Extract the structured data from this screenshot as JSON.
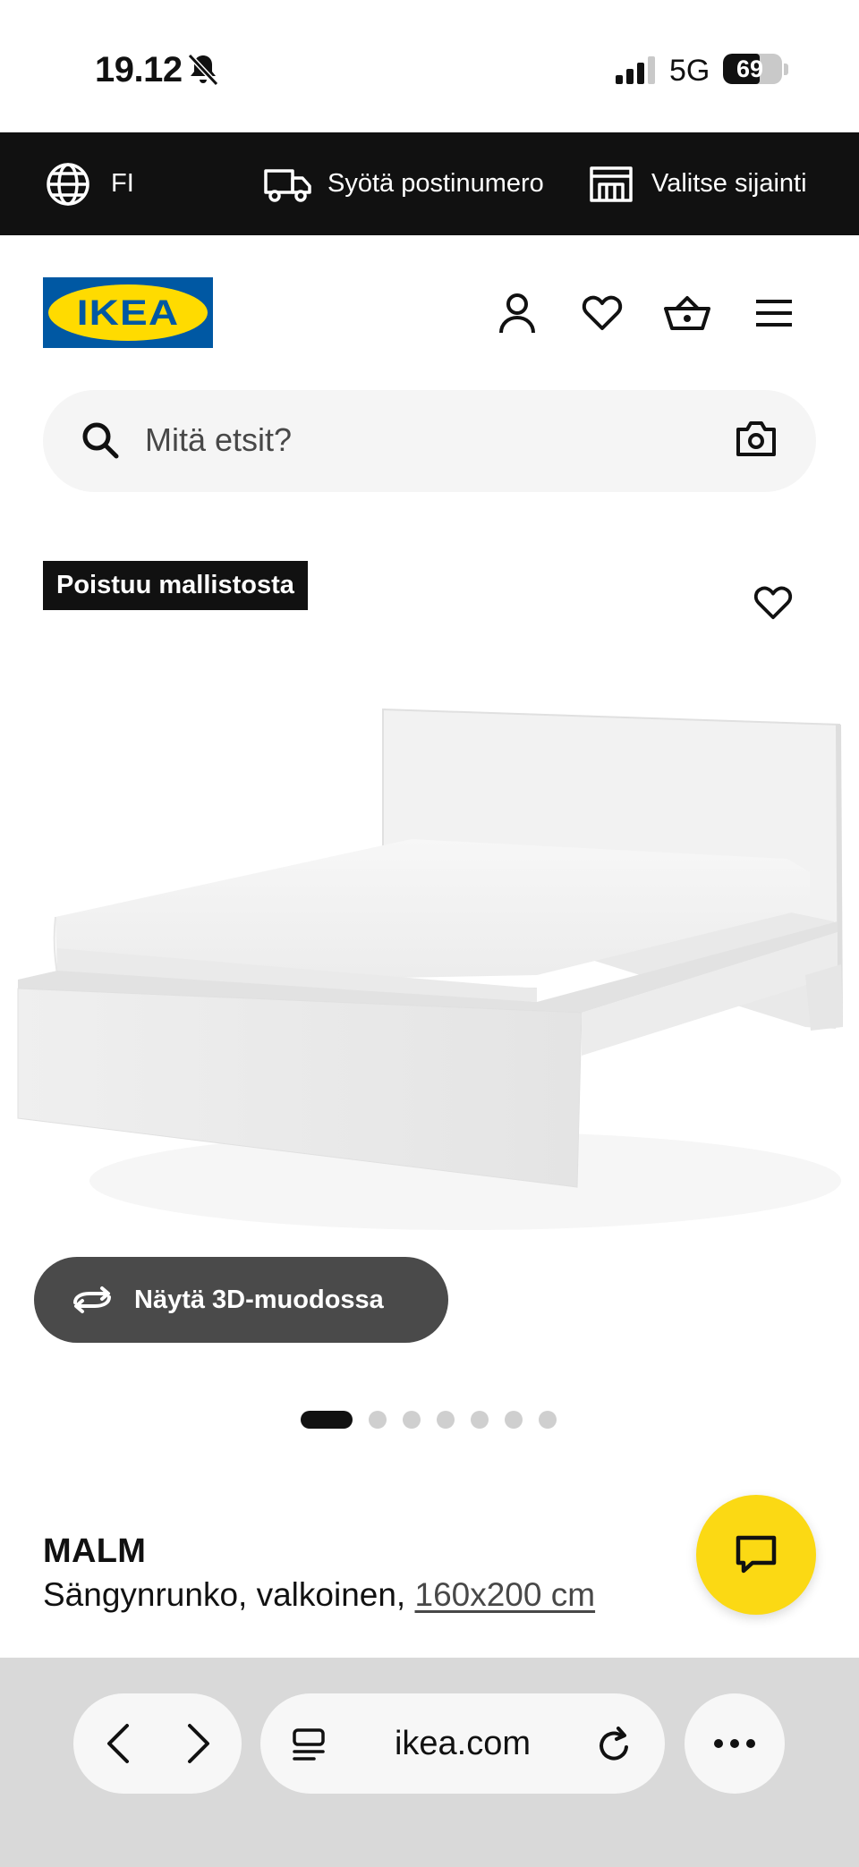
{
  "status_bar": {
    "time": "19.12",
    "network": "5G",
    "battery": "69",
    "battery_level_percent": 69
  },
  "utility_bar": {
    "language": "FI",
    "postcode_label": "Syötä postinumero",
    "location_label": "Valitse sijainti"
  },
  "header": {
    "logo_text": "IKEA",
    "icons": [
      "account-icon",
      "heart-icon",
      "basket-icon",
      "menu-icon"
    ]
  },
  "search": {
    "placeholder": "Mitä etsit?"
  },
  "product": {
    "badge": "Poistuu mallistosta",
    "view_3d_label": "Näytä 3D-muodossa",
    "carousel": {
      "total": 7,
      "active": 1
    },
    "name": "MALM",
    "description": "Sängynrunko, valkoinen, ",
    "size": "160x200 cm"
  },
  "browser": {
    "url": "ikea.com"
  },
  "colors": {
    "utility_bar_bg": "#111111",
    "ikea_blue": "#0058a3",
    "ikea_yellow": "#ffdb00",
    "chat_fab": "#fbd914",
    "button_3d_bg": "#4a4a4a"
  }
}
